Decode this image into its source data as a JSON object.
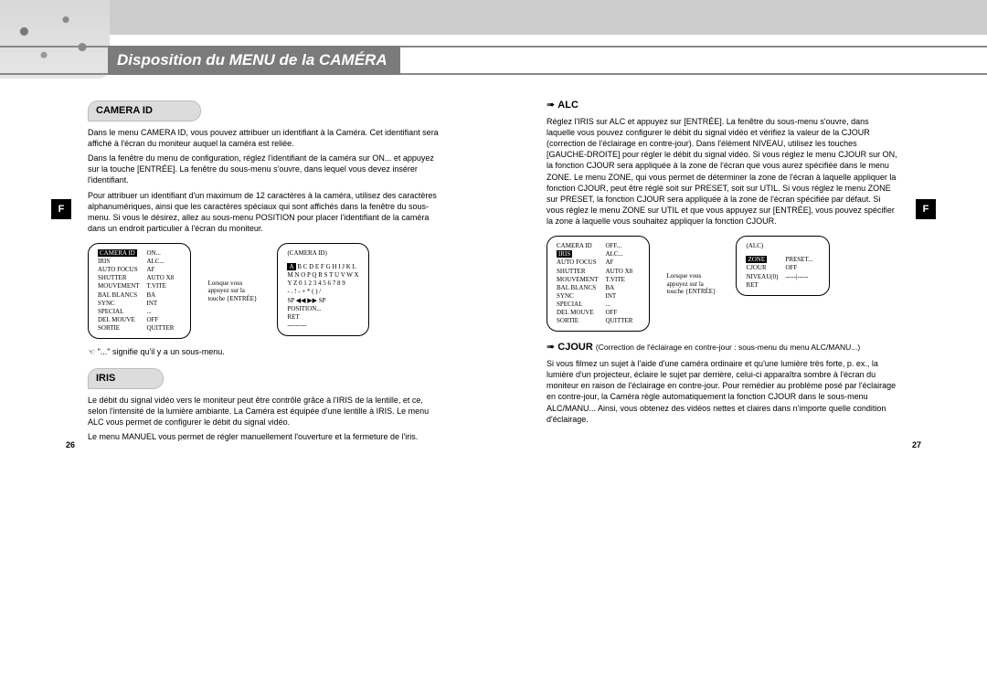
{
  "banner_title": "Disposition du MENU de la CAMÉRA",
  "side_tab": "F",
  "left": {
    "section1_title": "CAMERA ID",
    "p1": "Dans le menu CAMERA ID, vous pouvez attribuer un identifiant à la Caméra. Cet identifiant sera affiché à l'écran du moniteur auquel la caméra est reliée.",
    "p2": "Dans la fenêtre du menu de configuration, réglez l'identifiant de la caméra sur ON... et appuyez sur la touche [ENTRÉE]. La fenêtre du sous-menu s'ouvre, dans lequel vous devez insérer l'identifiant.",
    "p3": "Pour attribuer un identifiant d'un maximum de 12 caractères à la caméra, utilisez des caractères alphanumériques, ainsi que les caractères spéciaux qui sont affichés dans la fenêtre du sous-menu. Si vous le désirez, allez au sous-menu POSITION pour placer l'identifiant de la caméra dans un endroit particulier à l'écran du moniteur.",
    "menu1_hint": "Lorsque vous appuyez sur la touche {ENTRÉE}",
    "menu1": {
      "title": "CAMERA ID",
      "rows": [
        [
          "IRIS",
          "ALC..."
        ],
        [
          "AUTO FOCUS",
          "AF"
        ],
        [
          "SHUTTER",
          "AUTO X8"
        ],
        [
          "MOUVEMENT",
          "T.VITE"
        ],
        [
          "BAL BLANCS",
          "BA"
        ],
        [
          "SYNC",
          "INT"
        ],
        [
          "SPECIAL",
          "..."
        ],
        [
          "DEL MOUVE",
          "OFF"
        ],
        [
          "SORTIE",
          "QUITTER"
        ]
      ],
      "right_title": "ON..."
    },
    "menu2": {
      "title": "(CAMERA ID)",
      "lines": [
        "A B C D E F G H I J K L",
        "M N O P Q R S T U V W X",
        "Y Z  0 1 2 3 4 5 6 7 8 9",
        "- . ! - + * ( ) /",
        "SP ◀◀ ▶▶ SP",
        "POSITION...",
        "RET",
        "---------"
      ],
      "highlight_first": "A"
    },
    "note": "\"...\" signifie qu'il y a un sous-menu.",
    "section2_title": "IRIS",
    "p4": "Le débit du signal vidéo vers le moniteur peut être contrôlé grâce à l'IRIS de la lentille, et ce, selon l'intensité de la lumière ambiante. La Caméra est équipée d'une lentille à IRIS. Le menu ALC vous permet de configurer le débit du signal vidéo.",
    "p5": "Le menu MANUEL vous permet de régler manuellement l'ouverture et la fermeture de l'iris.",
    "pagenum": "26"
  },
  "right": {
    "alc_title": "ALC",
    "p1": "Réglez l'IRIS sur ALC et appuyez sur [ENTRÉE]. La fenêtre du sous-menu s'ouvre, dans laquelle vous pouvez configurer le débit du signal vidéo et vérifiez la valeur de la CJOUR (correction de l'éclairage en contre-jour). Dans l'élément NIVEAU, utilisez les touches [GAUCHE-DROITE] pour régler le débit du signal vidéo. Si vous réglez le menu CJOUR sur ON, la fonction CJOUR sera appliquée à la zone de l'écran que vous aurez spécifiée dans le menu ZONE. Le menu ZONE, qui vous permet de déterminer la zone de l'écran à laquelle appliquer la fonction CJOUR, peut être réglé soit sur PRESET, soit sur UTIL. Si vous réglez le menu ZONE sur PRESET, la fonction CJOUR sera appliquée à la zone de l'écran spécifiée par défaut. Si vous réglez le menu ZONE sur UTIL et que vous appuyez sur [ENTRÉE], vous pouvez spécifier la zone à laquelle vous souhaitez appliquer la fonction CJOUR.",
    "menu1_hint": "Lorsque vous appuyez sur la touche {ENTRÉE}",
    "menu1": {
      "rows": [
        [
          "CAMERA ID",
          "OFF..."
        ],
        [
          "IRIS",
          "ALC..."
        ],
        [
          "AUTO FOCUS",
          "AF"
        ],
        [
          "SHUTTER",
          "AUTO X8"
        ],
        [
          "MOUVEMENT",
          "T.VITE"
        ],
        [
          "BAL BLANCS",
          "BA"
        ],
        [
          "SYNC",
          "INT"
        ],
        [
          "SPECIAL",
          "..."
        ],
        [
          "DEL MOUVE",
          "OFF"
        ],
        [
          "SORTIE",
          "QUITTER"
        ]
      ],
      "highlight_row": 1
    },
    "menu2": {
      "title": "(ALC)",
      "rows": [
        [
          "ZONE",
          "PRESET..."
        ],
        [
          "CJOUR",
          "OFF"
        ],
        [
          "NIVEAU(0)",
          "-----|-----"
        ],
        [
          "RET",
          ""
        ]
      ],
      "highlight_row": 0
    },
    "cjour_title": "CJOUR",
    "cjour_desc": "(Correction de l'éclairage en contre-jour : sous-menu du menu ALC/MANU...)",
    "p2": "Si vous filmez un sujet à l'aide d'une caméra ordinaire et qu'une lumière très forte, p. ex., la lumière d'un projecteur, éclaire le sujet par derrière, celui-ci apparaîtra sombre à l'écran du moniteur en raison de l'éclairage en contre-jour. Pour remédier au problème posé par l'éclairage en contre-jour, la Caméra règle automatiquement la fonction CJOUR dans le sous-menu ALC/MANU... Ainsi, vous obtenez des vidéos nettes et claires dans n'importe quelle condition d'éclairage.",
    "pagenum": "27"
  }
}
